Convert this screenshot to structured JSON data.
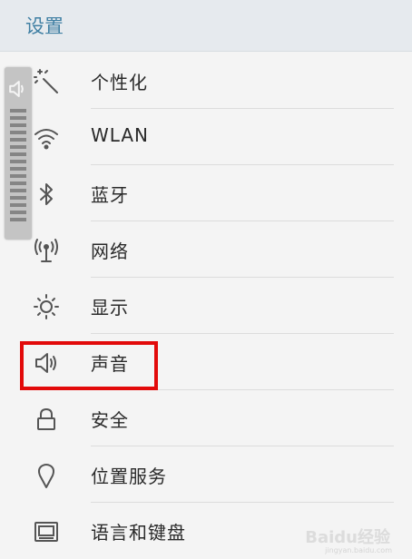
{
  "header": {
    "title": "设置"
  },
  "items": [
    {
      "label": "个性化",
      "icon": "magic-wand-icon"
    },
    {
      "label": "WLAN",
      "icon": "wifi-icon"
    },
    {
      "label": "蓝牙",
      "icon": "bluetooth-icon"
    },
    {
      "label": "网络",
      "icon": "antenna-icon"
    },
    {
      "label": "显示",
      "icon": "brightness-icon"
    },
    {
      "label": "声音",
      "icon": "speaker-icon"
    },
    {
      "label": "安全",
      "icon": "lock-icon"
    },
    {
      "label": "位置服务",
      "icon": "location-pin-icon"
    },
    {
      "label": "语言和键盘",
      "icon": "keyboard-icon"
    }
  ],
  "volume_overlay": {
    "icon": "speaker-icon"
  },
  "watermark": {
    "text": "Baidu经验",
    "sub": "jingyan.baidu.com"
  },
  "colors": {
    "highlight": "#e20a0a",
    "header_text": "#3f7fa3"
  }
}
